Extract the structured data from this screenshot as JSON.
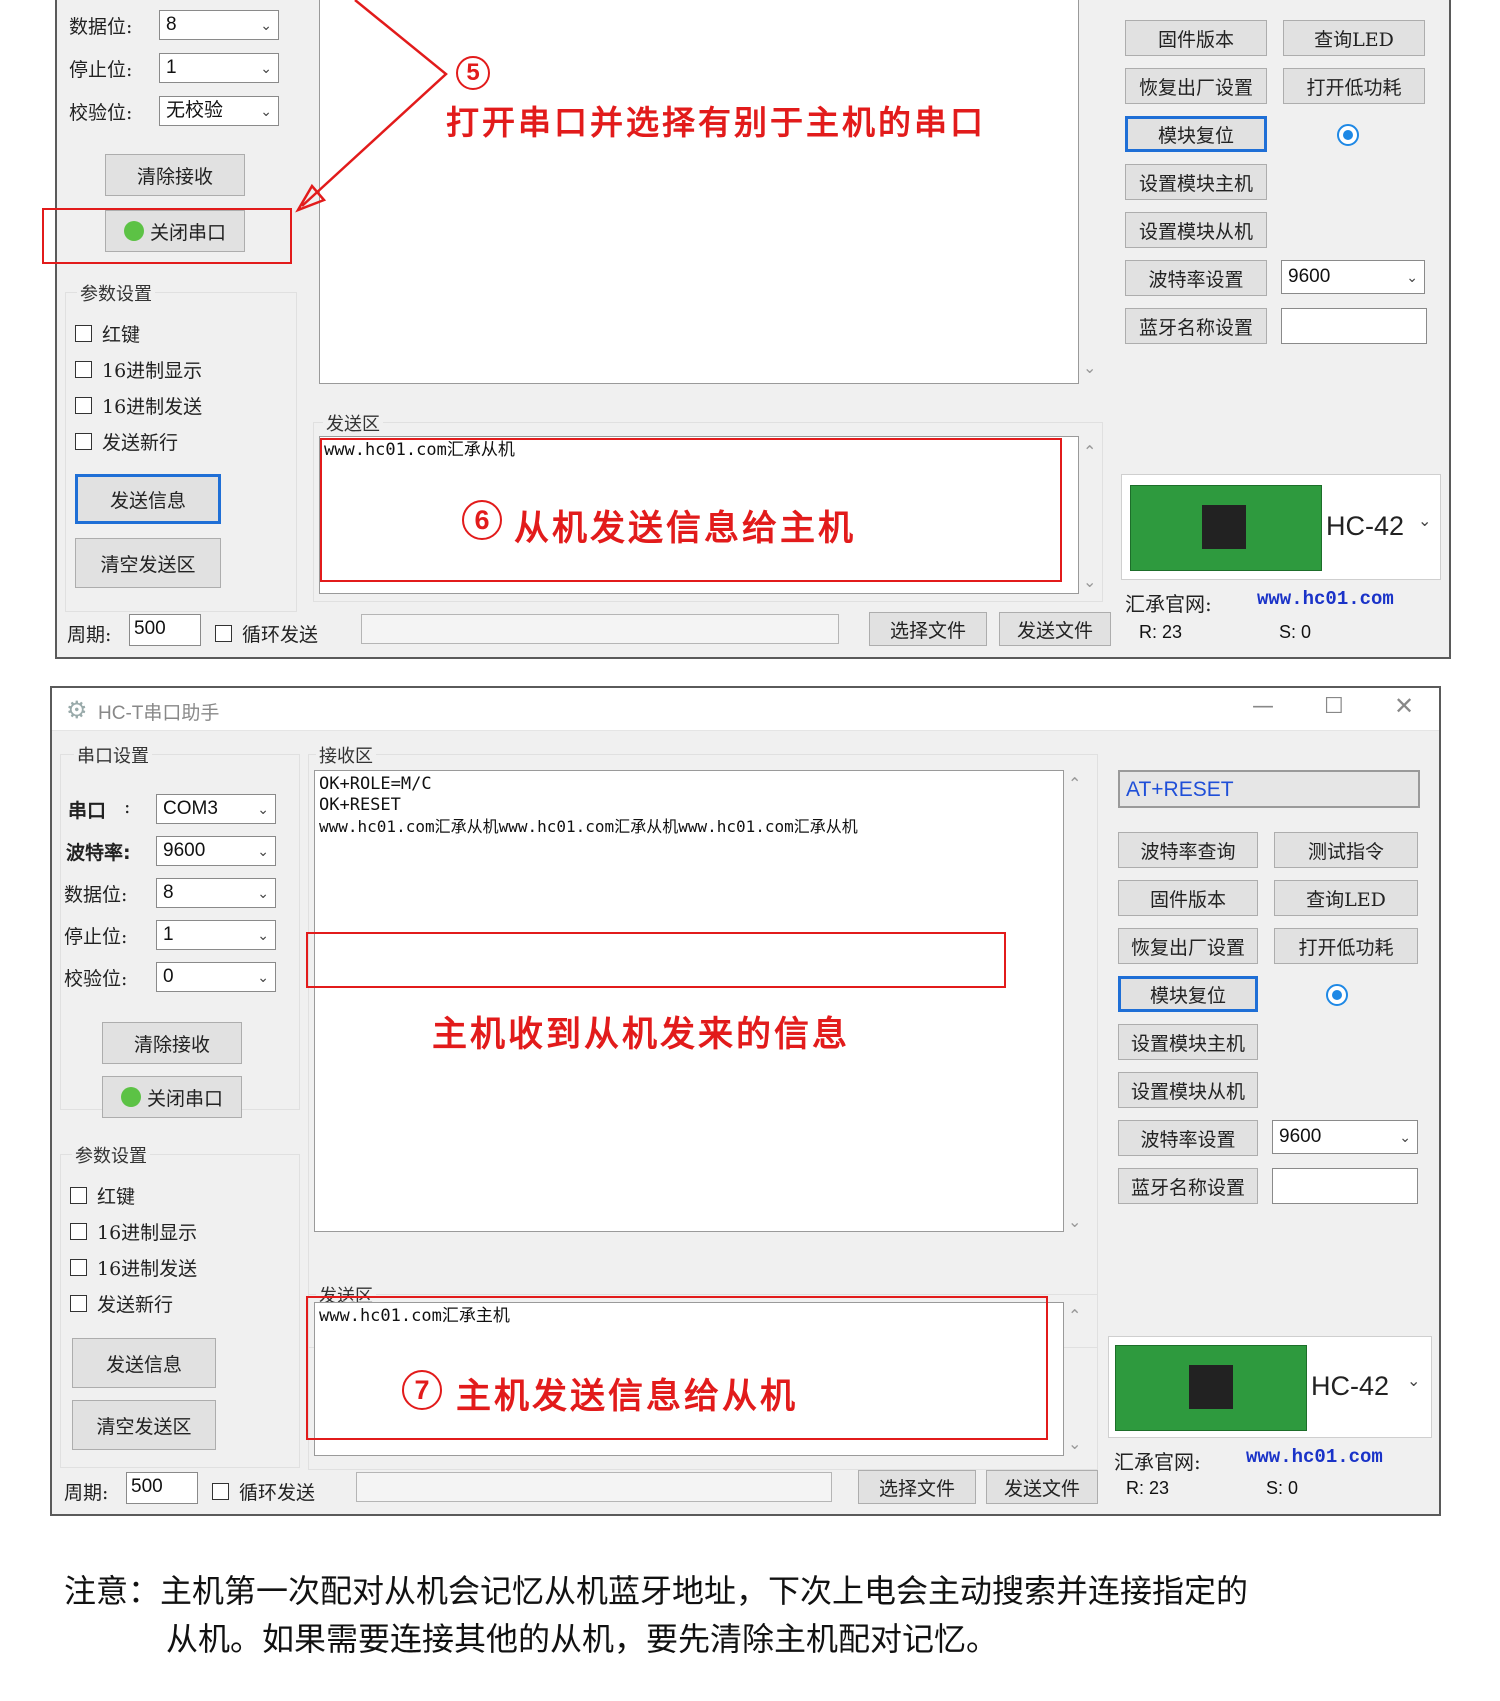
{
  "top_window": {
    "data_bits_label": "数据位:",
    "data_bits_value": "8",
    "stop_bits_label": "停止位:",
    "stop_bits_value": "1",
    "parity_label": "校验位:",
    "parity_value": "无校验",
    "clear_receive": "清除接收",
    "close_port": "关闭串口",
    "params_title": "参数设置",
    "checkboxes": [
      "红键",
      "16进制显示",
      "16进制发送",
      "发送新行"
    ],
    "send_info": "发送信息",
    "clear_send": "清空发送区",
    "send_area_title": "发送区",
    "send_text": "www.hc01.com汇承从机",
    "period_label": "周期:",
    "period_value": "500",
    "loop_send": "循环发送",
    "select_file": "选择文件",
    "send_file": "发送文件",
    "right_buttons": [
      "固件版本",
      "查询LED",
      "恢复出厂设置",
      "打开低功耗",
      "模块复位",
      "设置模块主机",
      "设置模块从机",
      "波特率设置",
      "蓝牙名称设置"
    ],
    "baud_value": "9600",
    "module_name": "HC-42",
    "site_label": "汇承官网:",
    "site_url": "www.hc01.com",
    "r_count": "R: 23",
    "s_count": "S: 0"
  },
  "annotations": {
    "step5_num": "5",
    "step5_text": "打开串口并选择有别于主机的串口",
    "step6_num": "6",
    "step6_text": "从机发送信息给主机",
    "host_recv_text": "主机收到从机发来的信息",
    "step7_num": "7",
    "step7_text": "主机发送信息给从机"
  },
  "bottom_window": {
    "title": "HC-T串口助手",
    "port_group_title": "串口设置",
    "port_label": "串口",
    "port_colon": ":",
    "port_value": "COM3",
    "baud_label": "波特率:",
    "baud_value": "9600",
    "data_bits_label": "数据位:",
    "data_bits_value": "8",
    "stop_bits_label": "停止位:",
    "stop_bits_value": "1",
    "parity_label": "校验位:",
    "parity_value": "0",
    "clear_receive": "清除接收",
    "close_port": "关闭串口",
    "params_title": "参数设置",
    "checkboxes": [
      "红键",
      "16进制显示",
      "16进制发送",
      "发送新行"
    ],
    "send_info": "发送信息",
    "clear_send": "清空发送区",
    "recv_title": "接收区",
    "recv_lines": [
      "OK+ROLE=M/C",
      "OK+RESET",
      "www.hc01.com汇承从机www.hc01.com汇承从机www.hc01.com汇承从机"
    ],
    "send_area_title": "发送区",
    "send_text": "www.hc01.com汇承主机",
    "at_command": "AT+RESET",
    "right_buttons": [
      "波特率查询",
      "测试指令",
      "固件版本",
      "查询LED",
      "恢复出厂设置",
      "打开低功耗",
      "模块复位",
      "设置模块主机",
      "设置模块从机",
      "波特率设置",
      "蓝牙名称设置"
    ],
    "rb_baud_value": "9600",
    "module_name": "HC-42",
    "site_label": "汇承官网:",
    "site_url": "www.hc01.com",
    "period_label": "周期:",
    "period_value": "500",
    "loop_send": "循环发送",
    "select_file": "选择文件",
    "send_file": "发送文件",
    "r_count": "R: 23",
    "s_count": "S: 0"
  },
  "note": {
    "line1": "注意：主机第一次配对从机会记忆从机蓝牙地址，下次上电会主动搜索并连接指定的",
    "line2": "从机。如果需要连接其他的从机，要先清除主机配对记忆。"
  },
  "colors": {
    "annotation_red": "#e21b1b",
    "link_blue": "#1a33c8",
    "focus_blue": "#1f6fd6",
    "led_green": "#5cc245"
  }
}
